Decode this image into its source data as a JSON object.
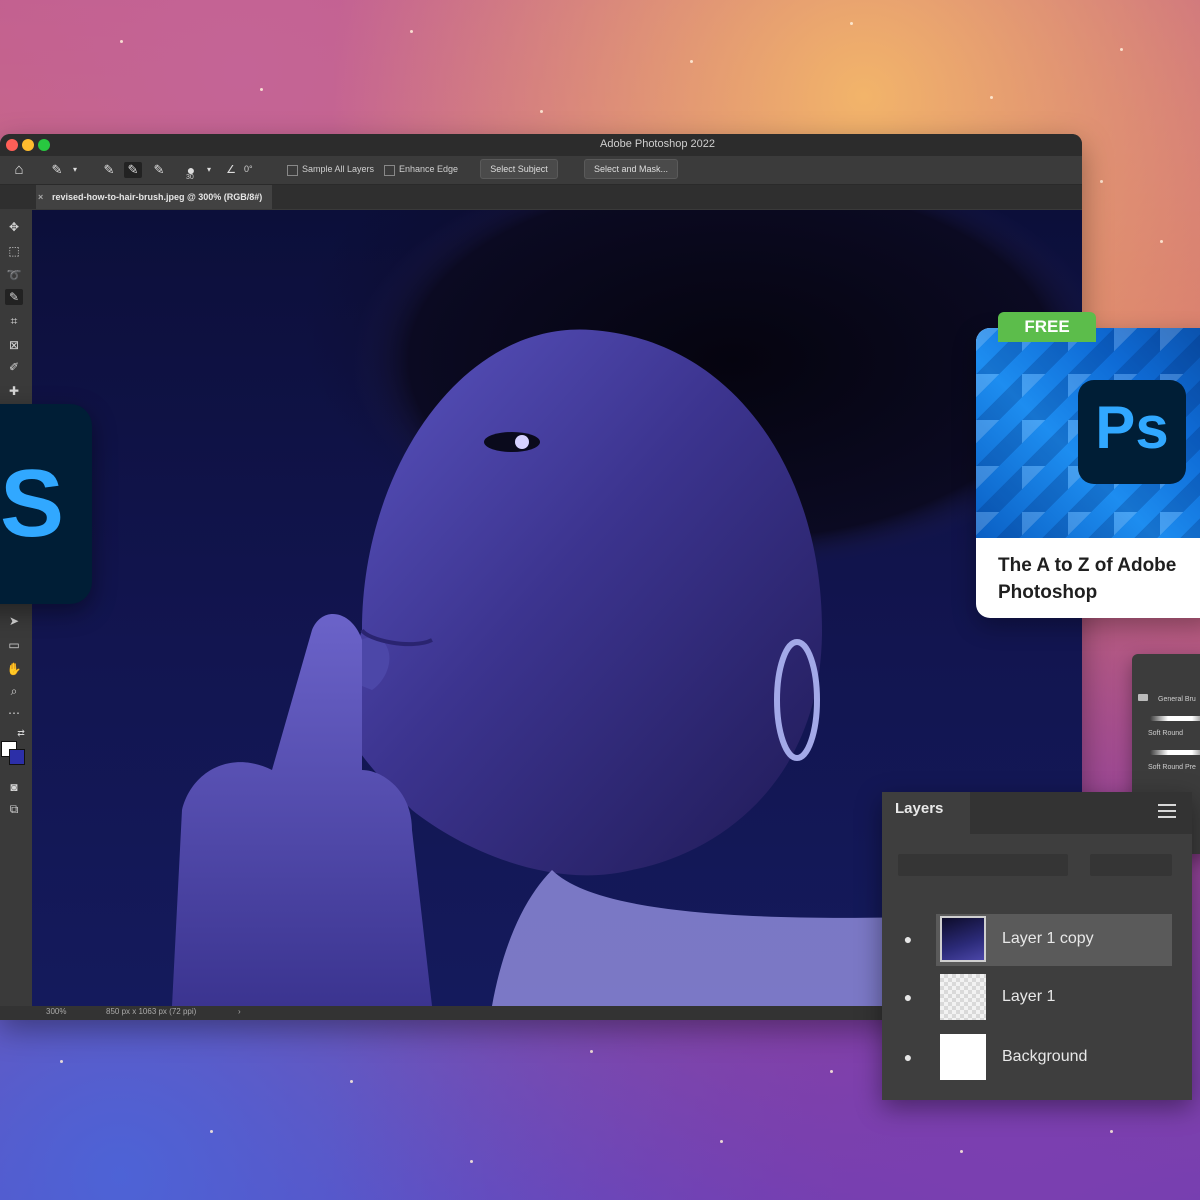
{
  "window": {
    "title": "Adobe Photoshop 2022",
    "traffic_lights": [
      "#ff5f57",
      "#febc2e",
      "#28c840"
    ]
  },
  "options_bar": {
    "brush_size": "30",
    "angle": "0°",
    "sample_all_layers": "Sample All Layers",
    "enhance_edge": "Enhance Edge",
    "select_subject": "Select Subject",
    "select_and_mask": "Select and Mask..."
  },
  "document_tab": {
    "label": "revised-how-to-hair-brush.jpeg @ 300% (RGB/8#)"
  },
  "status_bar": {
    "zoom": "300%",
    "doc_info": "850 px x 1063 px (72 ppi)"
  },
  "app_icon": {
    "letter": "S",
    "accent": "#31a8ff",
    "background": "#001e36"
  },
  "course_card": {
    "badge": "FREE",
    "icon_text": "Ps",
    "title": "The A to Z of Adobe Photoshop"
  },
  "brush_panel": {
    "group": "General Bru",
    "brushes": [
      "Soft Round",
      "Soft Round Pre"
    ]
  },
  "layers_panel": {
    "title": "Layers",
    "layers": [
      {
        "name": "Layer 1 copy",
        "selected": true
      },
      {
        "name": "Layer 1",
        "selected": false
      },
      {
        "name": "Background",
        "selected": false
      }
    ]
  }
}
